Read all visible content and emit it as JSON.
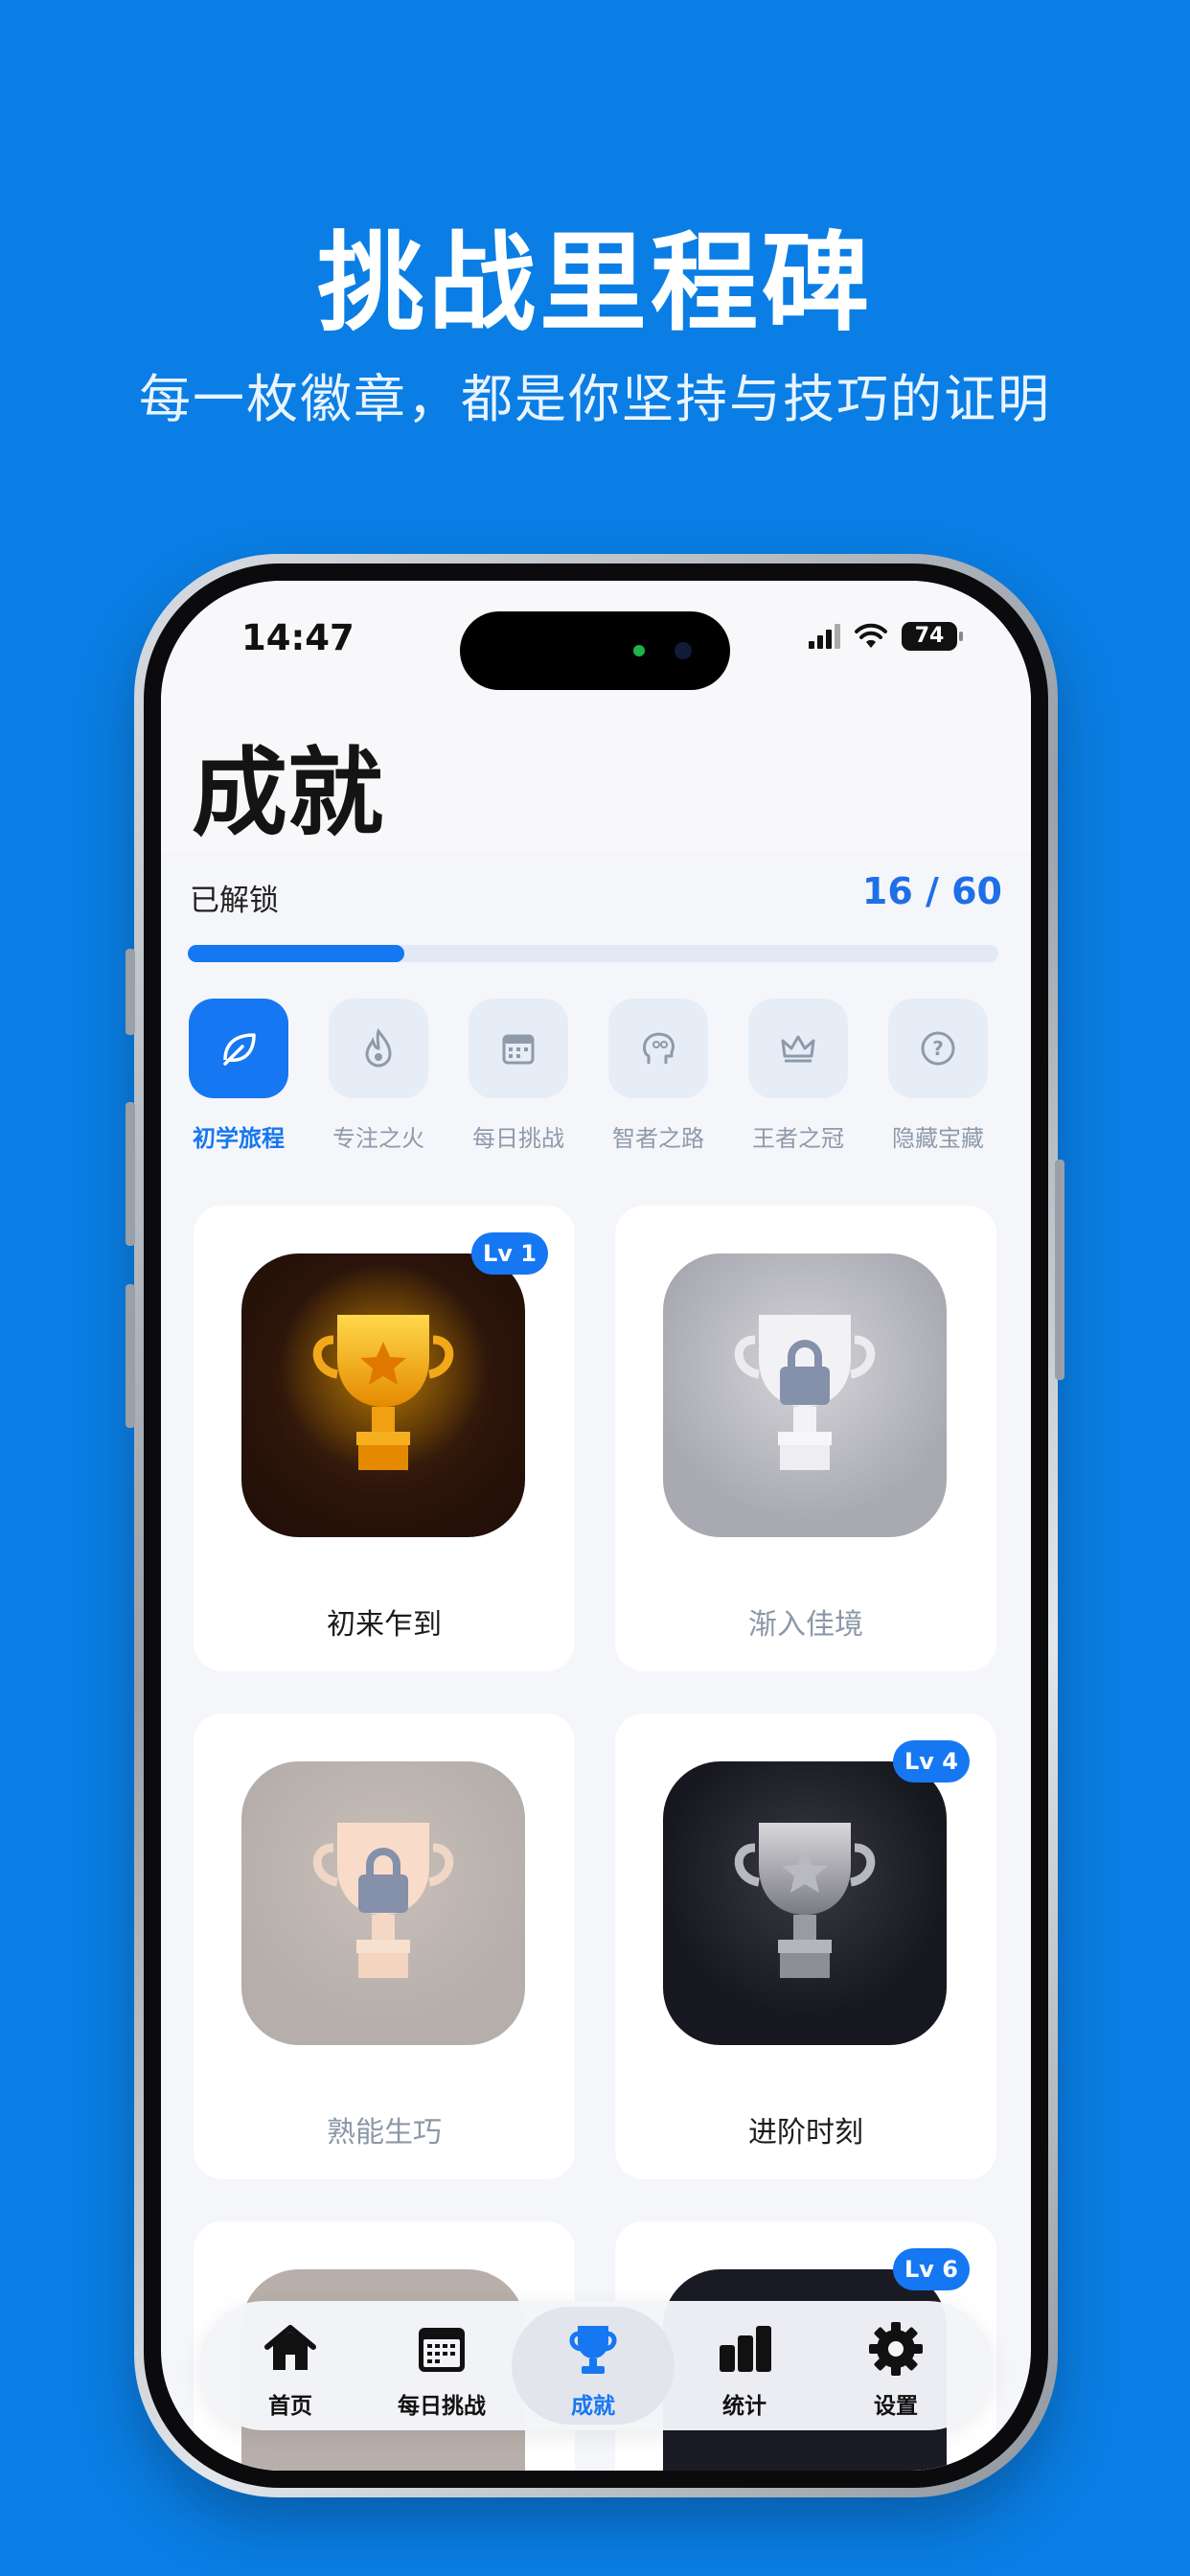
{
  "promo": {
    "title": "挑战里程碑",
    "subtitle": "每一枚徽章，都是你坚持与技巧的证明"
  },
  "status_bar": {
    "time": "14:47",
    "battery": "74"
  },
  "page": {
    "title": "成就"
  },
  "progress": {
    "label": "已解锁",
    "count_text": "16 / 60",
    "unlocked": 16,
    "total": 60
  },
  "categories": [
    {
      "label": "初学旅程",
      "icon": "leaf-icon",
      "active": true
    },
    {
      "label": "专注之火",
      "icon": "flame-icon",
      "active": false
    },
    {
      "label": "每日挑战",
      "icon": "calendar-icon",
      "active": false
    },
    {
      "label": "智者之路",
      "icon": "brain-icon",
      "active": false
    },
    {
      "label": "王者之冠",
      "icon": "crown-icon",
      "active": false
    },
    {
      "label": "隐藏宝藏",
      "icon": "question-icon",
      "active": false
    }
  ],
  "achievements": [
    {
      "name": "初来乍到",
      "level": "Lv 1",
      "locked": false,
      "style": "gold"
    },
    {
      "name": "渐入佳境",
      "level": "",
      "locked": true,
      "style": "silver-locked"
    },
    {
      "name": "熟能生巧",
      "level": "",
      "locked": true,
      "style": "bronze-locked"
    },
    {
      "name": "进阶时刻",
      "level": "Lv 4",
      "locked": false,
      "style": "silver"
    },
    {
      "name": "",
      "level": "",
      "locked": true,
      "style": "bronze-locked"
    },
    {
      "name": "",
      "level": "Lv 6",
      "locked": false,
      "style": "dark"
    }
  ],
  "tabbar": [
    {
      "label": "首页",
      "icon": "home-icon",
      "active": false
    },
    {
      "label": "每日挑战",
      "icon": "calendar-icon",
      "active": false
    },
    {
      "label": "成就",
      "icon": "trophy-icon",
      "active": true
    },
    {
      "label": "统计",
      "icon": "bar-chart-icon",
      "active": false
    },
    {
      "label": "设置",
      "icon": "gear-icon",
      "active": false
    }
  ],
  "colors": {
    "brand": "#1677F2",
    "background": "#0A7EE4",
    "gold": "#F5A600"
  }
}
